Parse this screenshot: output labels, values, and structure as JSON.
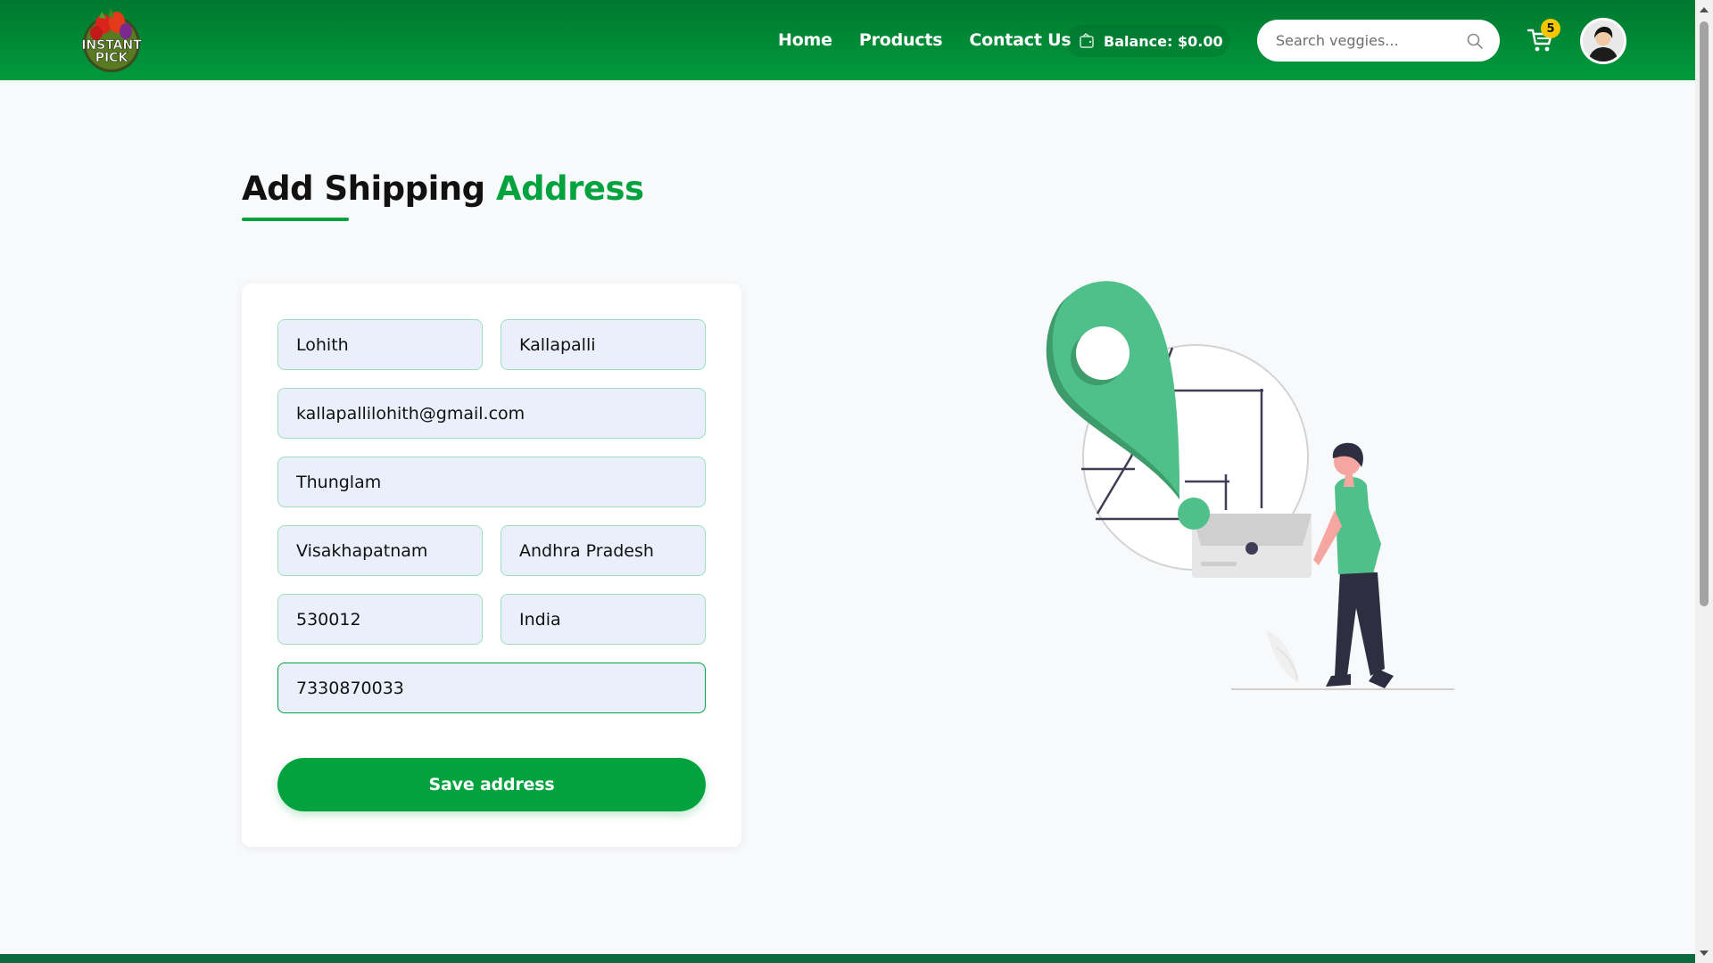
{
  "brand": {
    "logo_line1": "INSTANT",
    "logo_line2": "PICK",
    "primary_color": "#02a33e",
    "header_color": "#00782f"
  },
  "nav": {
    "items": [
      {
        "label": "Home"
      },
      {
        "label": "Products"
      },
      {
        "label": "Contact Us"
      }
    ],
    "balance_label": "Balance:",
    "balance_value": "$0.00",
    "search_placeholder": "Search veggies...",
    "cart_count": "5"
  },
  "page": {
    "title_main": "Add Shipping",
    "title_accent": "Address"
  },
  "form": {
    "first_name": "Lohith",
    "last_name": "Kallapalli",
    "email": "kallapallilohith@gmail.com",
    "street": "Thunglam",
    "city": "Visakhapatnam",
    "state": "Andhra Pradesh",
    "zip": "530012",
    "country": "India",
    "phone": "7330870033",
    "submit_label": "Save address"
  },
  "icons": {
    "search": "search-icon",
    "cart": "cart-icon",
    "wallet": "wallet-icon",
    "avatar": "user-avatar-icon"
  }
}
